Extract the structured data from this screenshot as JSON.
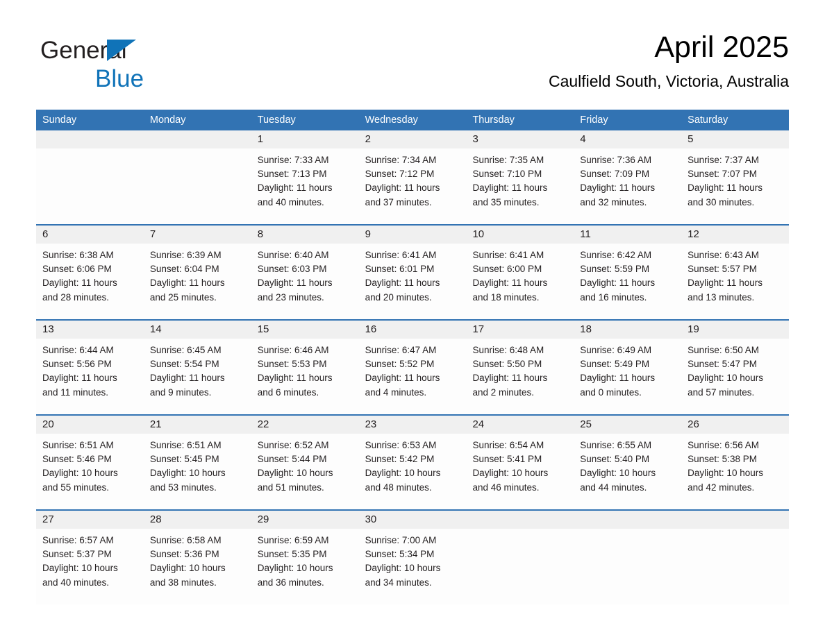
{
  "brand": {
    "name_part1": "General",
    "name_part2": "Blue",
    "triangle_color": "#1073b8",
    "text_color": "#231f20"
  },
  "header": {
    "title": "April 2025",
    "subtitle": "Caulfield South, Victoria, Australia"
  },
  "theme": {
    "header_blue": "#3273b3",
    "date_band_gray": "#f0f0f0",
    "cell_background": "#fdfdfd",
    "page_background": "#ffffff"
  },
  "calendar": {
    "weekday_headers": [
      "Sunday",
      "Monday",
      "Tuesday",
      "Wednesday",
      "Thursday",
      "Friday",
      "Saturday"
    ],
    "weeks": [
      {
        "dates": [
          "",
          "",
          "1",
          "2",
          "3",
          "4",
          "5"
        ],
        "cells": [
          {
            "l1": "",
            "l2": "",
            "l3": "",
            "l4": ""
          },
          {
            "l1": "",
            "l2": "",
            "l3": "",
            "l4": ""
          },
          {
            "l1": "Sunrise: 7:33 AM",
            "l2": "Sunset: 7:13 PM",
            "l3": "Daylight: 11 hours",
            "l4": "and 40 minutes."
          },
          {
            "l1": "Sunrise: 7:34 AM",
            "l2": "Sunset: 7:12 PM",
            "l3": "Daylight: 11 hours",
            "l4": "and 37 minutes."
          },
          {
            "l1": "Sunrise: 7:35 AM",
            "l2": "Sunset: 7:10 PM",
            "l3": "Daylight: 11 hours",
            "l4": "and 35 minutes."
          },
          {
            "l1": "Sunrise: 7:36 AM",
            "l2": "Sunset: 7:09 PM",
            "l3": "Daylight: 11 hours",
            "l4": "and 32 minutes."
          },
          {
            "l1": "Sunrise: 7:37 AM",
            "l2": "Sunset: 7:07 PM",
            "l3": "Daylight: 11 hours",
            "l4": "and 30 minutes."
          }
        ]
      },
      {
        "dates": [
          "6",
          "7",
          "8",
          "9",
          "10",
          "11",
          "12"
        ],
        "cells": [
          {
            "l1": "Sunrise: 6:38 AM",
            "l2": "Sunset: 6:06 PM",
            "l3": "Daylight: 11 hours",
            "l4": "and 28 minutes."
          },
          {
            "l1": "Sunrise: 6:39 AM",
            "l2": "Sunset: 6:04 PM",
            "l3": "Daylight: 11 hours",
            "l4": "and 25 minutes."
          },
          {
            "l1": "Sunrise: 6:40 AM",
            "l2": "Sunset: 6:03 PM",
            "l3": "Daylight: 11 hours",
            "l4": "and 23 minutes."
          },
          {
            "l1": "Sunrise: 6:41 AM",
            "l2": "Sunset: 6:01 PM",
            "l3": "Daylight: 11 hours",
            "l4": "and 20 minutes."
          },
          {
            "l1": "Sunrise: 6:41 AM",
            "l2": "Sunset: 6:00 PM",
            "l3": "Daylight: 11 hours",
            "l4": "and 18 minutes."
          },
          {
            "l1": "Sunrise: 6:42 AM",
            "l2": "Sunset: 5:59 PM",
            "l3": "Daylight: 11 hours",
            "l4": "and 16 minutes."
          },
          {
            "l1": "Sunrise: 6:43 AM",
            "l2": "Sunset: 5:57 PM",
            "l3": "Daylight: 11 hours",
            "l4": "and 13 minutes."
          }
        ]
      },
      {
        "dates": [
          "13",
          "14",
          "15",
          "16",
          "17",
          "18",
          "19"
        ],
        "cells": [
          {
            "l1": "Sunrise: 6:44 AM",
            "l2": "Sunset: 5:56 PM",
            "l3": "Daylight: 11 hours",
            "l4": "and 11 minutes."
          },
          {
            "l1": "Sunrise: 6:45 AM",
            "l2": "Sunset: 5:54 PM",
            "l3": "Daylight: 11 hours",
            "l4": "and 9 minutes."
          },
          {
            "l1": "Sunrise: 6:46 AM",
            "l2": "Sunset: 5:53 PM",
            "l3": "Daylight: 11 hours",
            "l4": "and 6 minutes."
          },
          {
            "l1": "Sunrise: 6:47 AM",
            "l2": "Sunset: 5:52 PM",
            "l3": "Daylight: 11 hours",
            "l4": "and 4 minutes."
          },
          {
            "l1": "Sunrise: 6:48 AM",
            "l2": "Sunset: 5:50 PM",
            "l3": "Daylight: 11 hours",
            "l4": "and 2 minutes."
          },
          {
            "l1": "Sunrise: 6:49 AM",
            "l2": "Sunset: 5:49 PM",
            "l3": "Daylight: 11 hours",
            "l4": "and 0 minutes."
          },
          {
            "l1": "Sunrise: 6:50 AM",
            "l2": "Sunset: 5:47 PM",
            "l3": "Daylight: 10 hours",
            "l4": "and 57 minutes."
          }
        ]
      },
      {
        "dates": [
          "20",
          "21",
          "22",
          "23",
          "24",
          "25",
          "26"
        ],
        "cells": [
          {
            "l1": "Sunrise: 6:51 AM",
            "l2": "Sunset: 5:46 PM",
            "l3": "Daylight: 10 hours",
            "l4": "and 55 minutes."
          },
          {
            "l1": "Sunrise: 6:51 AM",
            "l2": "Sunset: 5:45 PM",
            "l3": "Daylight: 10 hours",
            "l4": "and 53 minutes."
          },
          {
            "l1": "Sunrise: 6:52 AM",
            "l2": "Sunset: 5:44 PM",
            "l3": "Daylight: 10 hours",
            "l4": "and 51 minutes."
          },
          {
            "l1": "Sunrise: 6:53 AM",
            "l2": "Sunset: 5:42 PM",
            "l3": "Daylight: 10 hours",
            "l4": "and 48 minutes."
          },
          {
            "l1": "Sunrise: 6:54 AM",
            "l2": "Sunset: 5:41 PM",
            "l3": "Daylight: 10 hours",
            "l4": "and 46 minutes."
          },
          {
            "l1": "Sunrise: 6:55 AM",
            "l2": "Sunset: 5:40 PM",
            "l3": "Daylight: 10 hours",
            "l4": "and 44 minutes."
          },
          {
            "l1": "Sunrise: 6:56 AM",
            "l2": "Sunset: 5:38 PM",
            "l3": "Daylight: 10 hours",
            "l4": "and 42 minutes."
          }
        ]
      },
      {
        "dates": [
          "27",
          "28",
          "29",
          "30",
          "",
          "",
          ""
        ],
        "cells": [
          {
            "l1": "Sunrise: 6:57 AM",
            "l2": "Sunset: 5:37 PM",
            "l3": "Daylight: 10 hours",
            "l4": "and 40 minutes."
          },
          {
            "l1": "Sunrise: 6:58 AM",
            "l2": "Sunset: 5:36 PM",
            "l3": "Daylight: 10 hours",
            "l4": "and 38 minutes."
          },
          {
            "l1": "Sunrise: 6:59 AM",
            "l2": "Sunset: 5:35 PM",
            "l3": "Daylight: 10 hours",
            "l4": "and 36 minutes."
          },
          {
            "l1": "Sunrise: 7:00 AM",
            "l2": "Sunset: 5:34 PM",
            "l3": "Daylight: 10 hours",
            "l4": "and 34 minutes."
          },
          {
            "l1": "",
            "l2": "",
            "l3": "",
            "l4": ""
          },
          {
            "l1": "",
            "l2": "",
            "l3": "",
            "l4": ""
          },
          {
            "l1": "",
            "l2": "",
            "l3": "",
            "l4": ""
          }
        ]
      }
    ]
  }
}
